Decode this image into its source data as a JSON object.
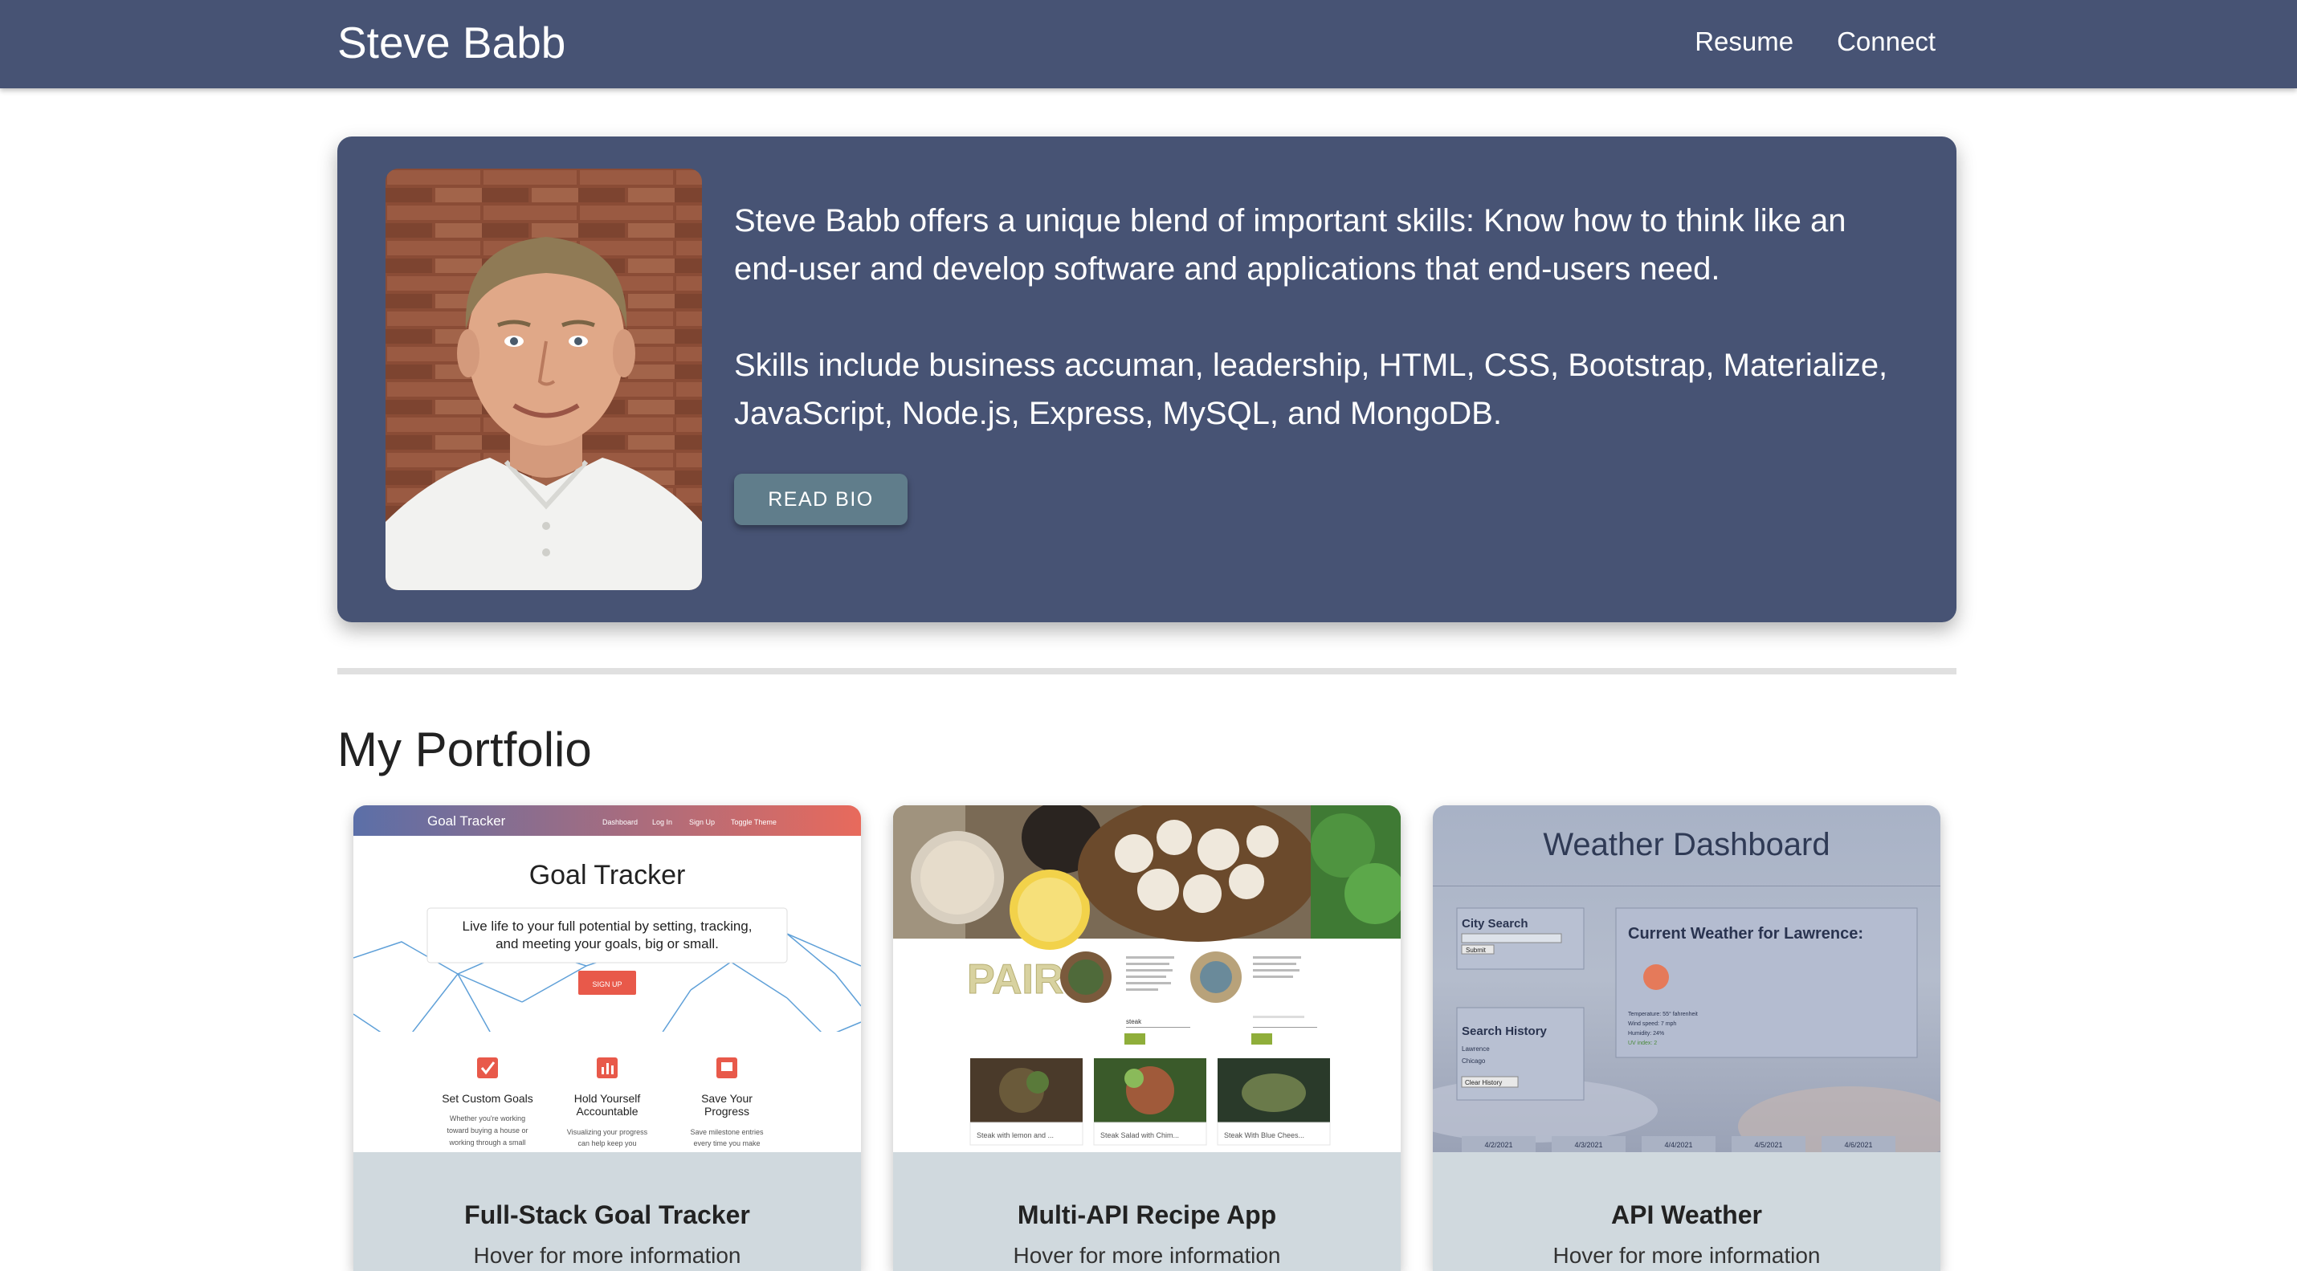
{
  "nav": {
    "brand": "Steve Babb",
    "links": [
      "Resume",
      "Connect"
    ]
  },
  "hero": {
    "paragraph1": "Steve Babb offers a unique blend of important skills: Know how to think like an end-user and develop software and applications that end-users need.",
    "paragraph2": "Skills include business accuman, leadership, HTML, CSS, Bootstrap, Materialize, JavaScript, Node.js, Express, MySQL, and MongoDB.",
    "button": "READ BIO"
  },
  "portfolio": {
    "heading": "My Portfolio",
    "cards": [
      {
        "title": "Full-Stack Goal Tracker",
        "subtitle": "Hover for more information",
        "screenshot": {
          "brand": "Goal Tracker",
          "nav": [
            "Dashboard",
            "Log In",
            "Sign Up",
            "Toggle Theme"
          ],
          "heading": "Goal Tracker",
          "tagline1": "Live life to your full potential by setting, tracking,",
          "tagline2": "and meeting your goals, big or small.",
          "signup": "SIGN UP",
          "features": [
            {
              "title": "Set Custom Goals",
              "text1": "Whether you're working",
              "text2": "toward buying a house or",
              "text3": "working through a small"
            },
            {
              "title": "Hold Yourself Accountable",
              "text1": "Visualizing your progress",
              "text2": "can help keep you",
              "text3": ""
            },
            {
              "title": "Save Your Progress",
              "text1": "Save milestone entries",
              "text2": "every time you make",
              "text3": ""
            }
          ]
        }
      },
      {
        "title": "Multi-API Recipe App",
        "subtitle": "Hover for more information",
        "screenshot": {
          "logo": "PAIR",
          "captions": [
            "Steak with lemon and ...",
            "Steak Salad with Chim...",
            "Steak With Blue Chees..."
          ],
          "search_value": "steak"
        }
      },
      {
        "title": "API Weather",
        "subtitle": "Hover for more information",
        "screenshot": {
          "heading": "Weather Dashboard",
          "city_search": "City Search",
          "submit": "Submit",
          "current": "Current Weather for Lawrence:",
          "history": "Search History",
          "history_items": [
            "Lawrence",
            "Chicago"
          ],
          "clear": "Clear History",
          "stats": [
            "Temperature: 55° fahrenheit",
            "Wind speed: 7 mph",
            "Humidity: 24%",
            "UV index: 2"
          ],
          "dates": [
            "4/2/2021",
            "4/3/2021",
            "4/4/2021",
            "4/5/2021",
            "4/6/2021"
          ]
        }
      }
    ]
  },
  "colors": {
    "navbar": "#475374",
    "hero": "#475374",
    "button": "#607d8b",
    "card_footer": "#d0d9de"
  }
}
